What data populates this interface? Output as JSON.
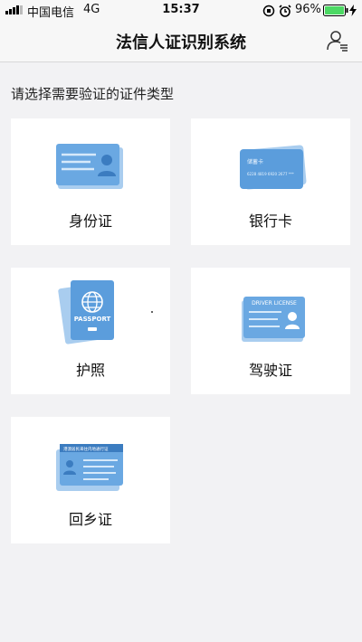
{
  "status_bar": {
    "carrier": "中国电信",
    "network": "4G",
    "time": "15:37",
    "battery": "96%"
  },
  "nav": {
    "title": "法信人证识别系统",
    "user_icon": "user-list-icon"
  },
  "section_title": "请选择需要验证的证件类型",
  "cards": [
    {
      "label": "身份证",
      "icon": "id-card-icon"
    },
    {
      "label": "银行卡",
      "icon": "bank-card-icon",
      "card_text": "储蓄卡",
      "card_number": "6228 4819 6920 2677 ***"
    },
    {
      "label": "护照",
      "icon": "passport-icon",
      "card_text": "PASSPORT"
    },
    {
      "label": "驾驶证",
      "icon": "driver-license-icon",
      "card_text": "DRIVER LICENSE"
    },
    {
      "label": "回乡证",
      "icon": "home-return-permit-icon",
      "card_text": "港澳居民来往内地通行证"
    }
  ],
  "colors": {
    "accent_blue": "#5b9ddc",
    "light_blue": "#a9cdef",
    "battery_green": "#4cd964"
  }
}
